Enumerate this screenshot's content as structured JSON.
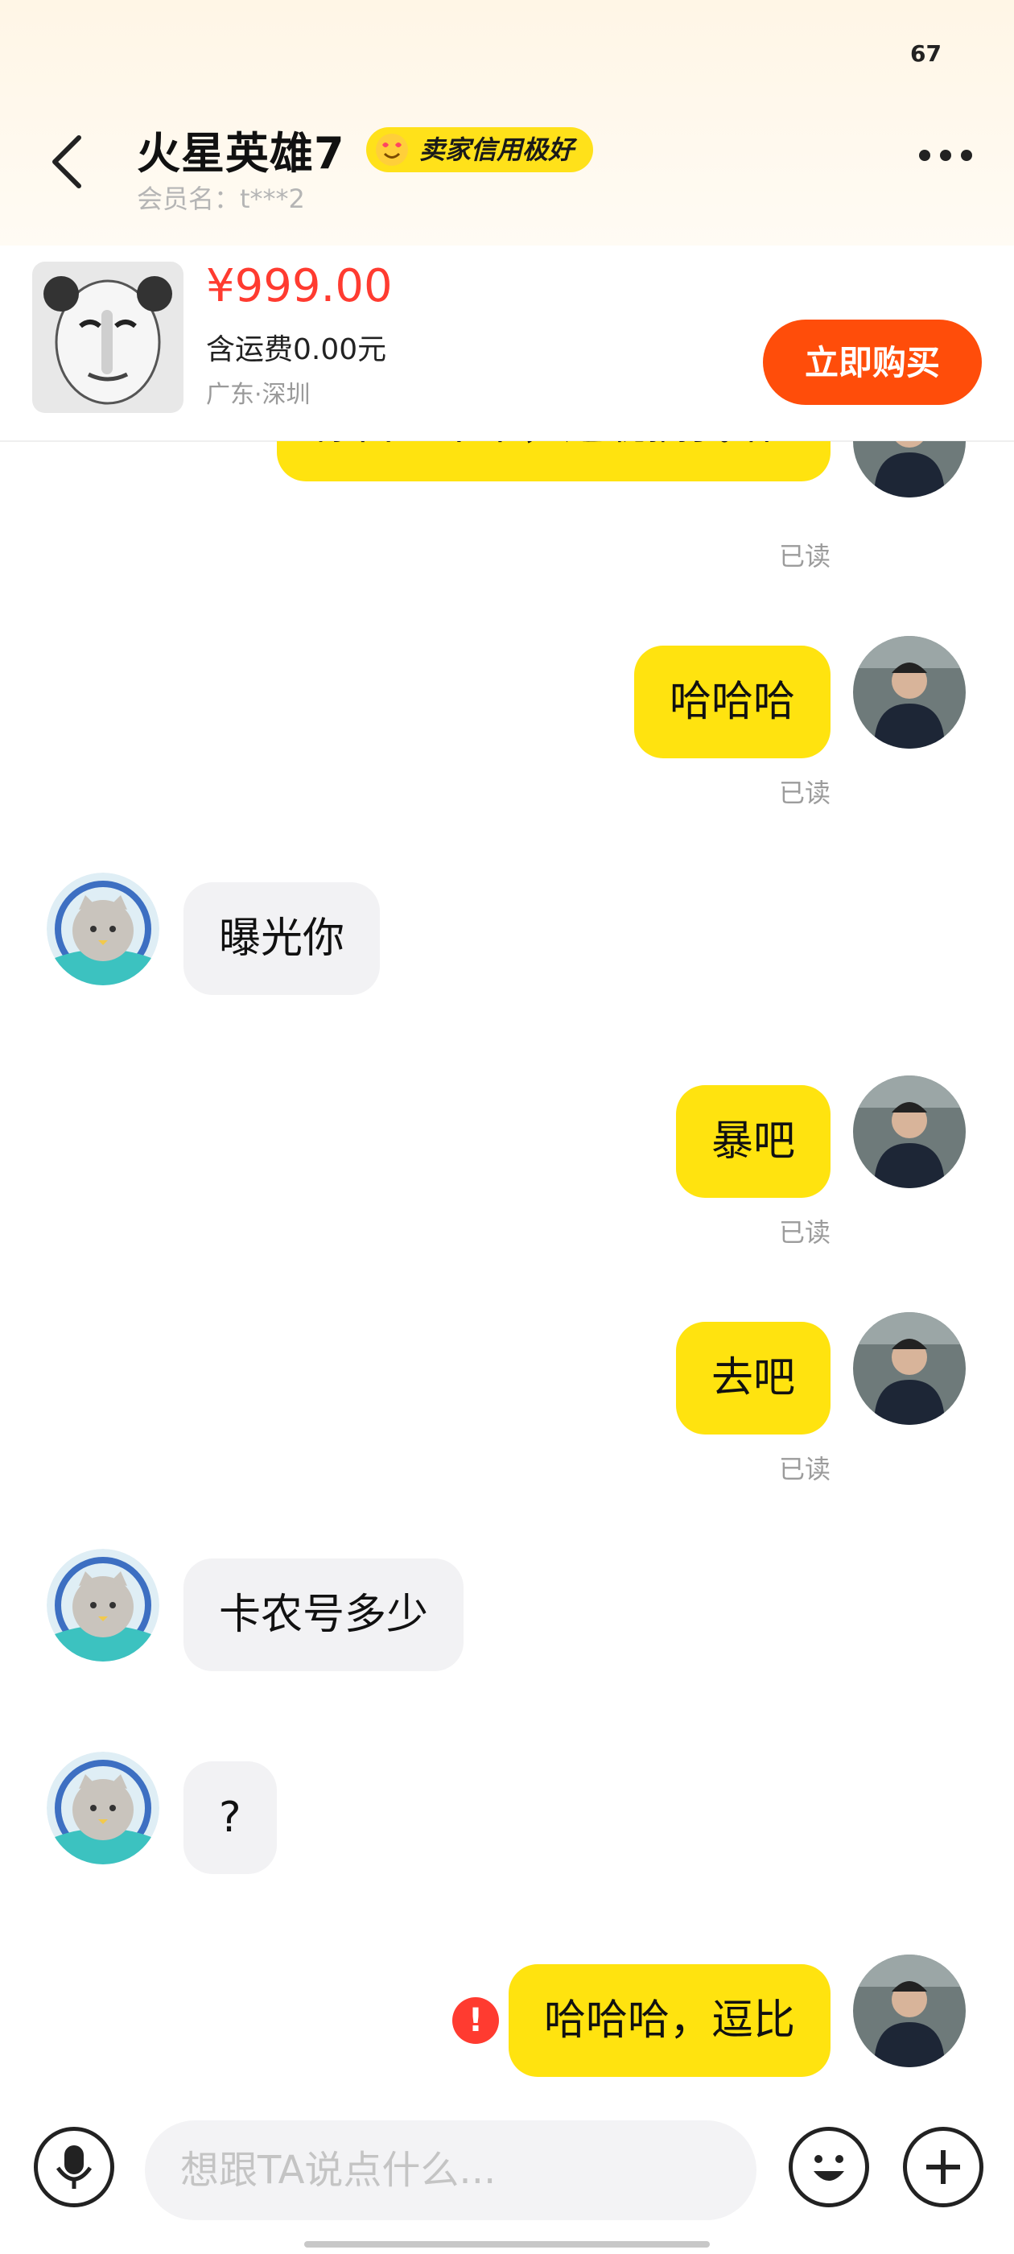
{
  "status_bar": {
    "battery": "67"
  },
  "header": {
    "seller_name": "火星英雄7",
    "credit_badge": "卖家信用极好",
    "member_name": "会员名：t***2"
  },
  "product": {
    "price": "¥999.00",
    "shipping": "含运费0.00元",
    "location": "广东·深圳",
    "buy_label": "立即购买"
  },
  "messages": [
    {
      "from": "me",
      "text": "你自己不下，还耽搁我咯?",
      "read": "已读"
    },
    {
      "from": "me",
      "text": "哈哈哈",
      "read": "已读"
    },
    {
      "from": "other",
      "text": "曝光你"
    },
    {
      "from": "me",
      "text": "暴吧",
      "read": "已读"
    },
    {
      "from": "me",
      "text": "去吧",
      "read": "已读"
    },
    {
      "from": "other",
      "text": "卡农号多少"
    },
    {
      "from": "other",
      "text": "?"
    },
    {
      "from": "me",
      "text": "哈哈哈，逗比",
      "failed": true
    }
  ],
  "input": {
    "placeholder": "想跟TA说点什么..."
  },
  "colors": {
    "accent": "#ffe30f",
    "buy": "#ff4d0a",
    "price": "#ff3b30",
    "error": "#ff3b30"
  }
}
